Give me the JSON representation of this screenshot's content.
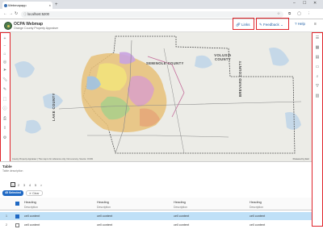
{
  "browser": {
    "tab_title": "Webmapapp",
    "url": "localhost:5200",
    "new_tab_symbol": "+",
    "close_symbol": "×"
  },
  "header": {
    "title": "OCPA Webmap",
    "subtitle": "Orange County Property Appraiser",
    "links_label": "Links",
    "feedback_label": "Feedback",
    "help_label": "Help"
  },
  "map": {
    "labels": [
      "SEMINOLE COUNTY",
      "VOLUSIA COUNTY",
      "BREVARD COUNTY",
      "LAKE COUNTY"
    ],
    "attribution": "County Property Appraiser | The map is for reference only. Not a survey. Source: OCPA",
    "esri": "Powered by Esri"
  },
  "panel": {
    "title": "Table",
    "description": "Table description",
    "pages": [
      "1",
      "2",
      "3",
      "4",
      "5"
    ],
    "next_symbol": ">",
    "selected_badge": "45 Selected",
    "clear_label": "Clear",
    "columns": [
      {
        "heading": "Heading",
        "description": "Description"
      },
      {
        "heading": "Heading",
        "description": "Description"
      },
      {
        "heading": "Heading",
        "description": "Description"
      },
      {
        "heading": "Heading",
        "description": "Description"
      }
    ],
    "rows": [
      {
        "num": "1",
        "cells": [
          "cell content",
          "cell content",
          "cell content",
          "cell content"
        ],
        "selected": true
      },
      {
        "num": "2",
        "cells": [
          "cell content",
          "cell content",
          "cell content",
          "cell content"
        ],
        "selected": false
      }
    ]
  }
}
